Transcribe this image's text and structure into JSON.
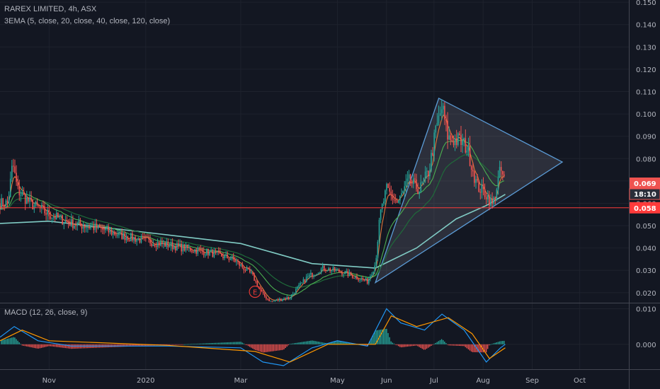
{
  "header": {
    "title": "RAREX LIMITED, 4h, ASX",
    "indicator": "3EMA (5, close, 20, close, 40, close, 120, close)"
  },
  "macd_header": {
    "label": "MACD (12, 26, close, 9)"
  },
  "price_tags": {
    "last_price": "0.069",
    "countdown": "18:10",
    "hline_price": "0.058"
  },
  "colors": {
    "background": "#131722",
    "grid": "#1e222d",
    "up": "#26a69a",
    "down": "#ef5350",
    "ema5": "#e0763a",
    "ema20": "#4caf50",
    "ema40": "#1f6b3a",
    "ema120": "#80cbc4",
    "triangle": "#5b9bd5",
    "hline": "#ff3b3b",
    "macd": "#2196f3",
    "signal": "#ff9800",
    "earnings": "#e53935"
  },
  "chart_data": [
    {
      "type": "candlestick",
      "title": "RAREX LIMITED, 4h, ASX",
      "y_ticks": [
        "0.020",
        "0.030",
        "0.040",
        "0.050",
        "0.060",
        "0.070",
        "0.080",
        "0.090",
        "0.100",
        "0.110",
        "0.120",
        "0.130",
        "0.140",
        "0.150"
      ],
      "x_ticks": [
        "Nov",
        "2020",
        "Mar",
        "May",
        "Jun",
        "Jul",
        "Aug",
        "Sep",
        "Oct"
      ],
      "ylim": [
        0.0155,
        0.151
      ],
      "series_path": [
        {
          "x": "2019-10-06",
          "y": 0.06
        },
        {
          "x": "2019-10-09",
          "y": 0.078
        },
        {
          "x": "2019-10-12",
          "y": 0.066
        },
        {
          "x": "2019-10-20",
          "y": 0.06
        },
        {
          "x": "2019-11-01",
          "y": 0.055
        },
        {
          "x": "2019-11-15",
          "y": 0.051
        },
        {
          "x": "2019-12-01",
          "y": 0.049
        },
        {
          "x": "2019-12-20",
          "y": 0.045
        },
        {
          "x": "2020-01-10",
          "y": 0.042
        },
        {
          "x": "2020-01-25",
          "y": 0.04
        },
        {
          "x": "2020-02-10",
          "y": 0.038
        },
        {
          "x": "2020-02-25",
          "y": 0.035
        },
        {
          "x": "2020-03-08",
          "y": 0.028
        },
        {
          "x": "2020-03-15",
          "y": 0.019
        },
        {
          "x": "2020-03-20",
          "y": 0.016
        },
        {
          "x": "2020-04-01",
          "y": 0.018
        },
        {
          "x": "2020-04-12",
          "y": 0.027
        },
        {
          "x": "2020-04-22",
          "y": 0.031
        },
        {
          "x": "2020-05-05",
          "y": 0.029
        },
        {
          "x": "2020-05-20",
          "y": 0.025
        },
        {
          "x": "2020-05-25",
          "y": 0.033
        },
        {
          "x": "2020-05-28",
          "y": 0.055
        },
        {
          "x": "2020-06-01",
          "y": 0.066
        },
        {
          "x": "2020-06-08",
          "y": 0.06
        },
        {
          "x": "2020-06-15",
          "y": 0.07
        },
        {
          "x": "2020-06-22",
          "y": 0.066
        },
        {
          "x": "2020-06-28",
          "y": 0.075
        },
        {
          "x": "2020-07-02",
          "y": 0.092
        },
        {
          "x": "2020-07-06",
          "y": 0.103
        },
        {
          "x": "2020-07-10",
          "y": 0.089
        },
        {
          "x": "2020-07-17",
          "y": 0.088
        },
        {
          "x": "2020-07-22",
          "y": 0.085
        },
        {
          "x": "2020-07-28",
          "y": 0.068
        },
        {
          "x": "2020-08-03",
          "y": 0.064
        },
        {
          "x": "2020-08-07",
          "y": 0.059
        },
        {
          "x": "2020-08-12",
          "y": 0.075
        },
        {
          "x": "2020-08-15",
          "y": 0.069
        }
      ],
      "ema_series": [
        {
          "name": "EMA 120",
          "values": [
            {
              "x": "2019-10-01",
              "y": 0.051
            },
            {
              "x": "2019-11-01",
              "y": 0.052
            },
            {
              "x": "2020-01-01",
              "y": 0.047
            },
            {
              "x": "2020-03-01",
              "y": 0.042
            },
            {
              "x": "2020-04-15",
              "y": 0.033
            },
            {
              "x": "2020-05-25",
              "y": 0.031
            },
            {
              "x": "2020-06-20",
              "y": 0.04
            },
            {
              "x": "2020-07-15",
              "y": 0.053
            },
            {
              "x": "2020-08-03",
              "y": 0.059
            },
            {
              "x": "2020-08-15",
              "y": 0.064
            }
          ]
        }
      ],
      "drawings": {
        "triangle": [
          {
            "x": "2020-05-25",
            "y": 0.0245
          },
          {
            "x": "2020-07-04",
            "y": 0.107
          },
          {
            "x": "2020-09-20",
            "y": 0.0785
          }
        ],
        "horizontal_line": 0.058
      },
      "event_marker": {
        "label": "E",
        "x": "2020-03-10",
        "y": 0.0185
      }
    },
    {
      "type": "line",
      "title": "MACD (12, 26, close, 9)",
      "y_ticks": [
        "0.000",
        "0.010"
      ],
      "ylim": [
        -0.007,
        0.0115
      ],
      "series": [
        {
          "name": "MACD",
          "values": [
            {
              "x": "2019-10-01",
              "y": 0.002
            },
            {
              "x": "2019-10-10",
              "y": 0.005
            },
            {
              "x": "2019-10-25",
              "y": 0.001
            },
            {
              "x": "2019-11-15",
              "y": -0.0005
            },
            {
              "x": "2020-01-15",
              "y": -0.0005
            },
            {
              "x": "2020-03-01",
              "y": -0.001
            },
            {
              "x": "2020-03-15",
              "y": -0.005
            },
            {
              "x": "2020-03-28",
              "y": -0.006
            },
            {
              "x": "2020-04-15",
              "y": -0.001
            },
            {
              "x": "2020-05-01",
              "y": 0.001
            },
            {
              "x": "2020-05-20",
              "y": -0.0005
            },
            {
              "x": "2020-06-01",
              "y": 0.01
            },
            {
              "x": "2020-06-10",
              "y": 0.006
            },
            {
              "x": "2020-06-25",
              "y": 0.004
            },
            {
              "x": "2020-07-06",
              "y": 0.0085
            },
            {
              "x": "2020-07-20",
              "y": 0.004
            },
            {
              "x": "2020-08-03",
              "y": -0.005
            },
            {
              "x": "2020-08-12",
              "y": -0.001
            },
            {
              "x": "2020-08-15",
              "y": 0.0
            }
          ]
        },
        {
          "name": "Signal",
          "values": [
            {
              "x": "2019-10-01",
              "y": 0.001
            },
            {
              "x": "2019-10-15",
              "y": 0.004
            },
            {
              "x": "2019-11-01",
              "y": 0.001
            },
            {
              "x": "2020-01-15",
              "y": -0.0003
            },
            {
              "x": "2020-03-10",
              "y": -0.002
            },
            {
              "x": "2020-04-01",
              "y": -0.005
            },
            {
              "x": "2020-04-25",
              "y": 0.0
            },
            {
              "x": "2020-05-25",
              "y": 0.0
            },
            {
              "x": "2020-06-04",
              "y": 0.008
            },
            {
              "x": "2020-06-20",
              "y": 0.005
            },
            {
              "x": "2020-07-10",
              "y": 0.0075
            },
            {
              "x": "2020-07-25",
              "y": 0.003
            },
            {
              "x": "2020-08-05",
              "y": -0.004
            },
            {
              "x": "2020-08-15",
              "y": -0.001
            }
          ]
        }
      ]
    }
  ]
}
